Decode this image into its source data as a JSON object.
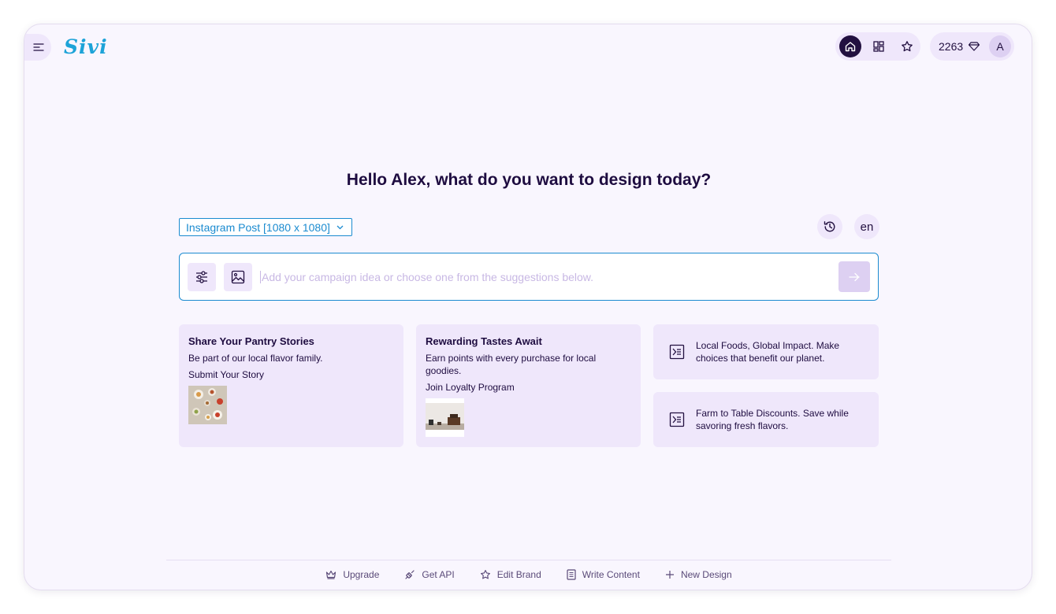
{
  "app": {
    "logo_text": "Sivi"
  },
  "header": {
    "nav": [
      {
        "icon": "home-icon",
        "active": true
      },
      {
        "icon": "grid-icon",
        "active": false
      },
      {
        "icon": "star-icon",
        "active": false
      }
    ],
    "credits": "2263",
    "avatar_initial": "A"
  },
  "main": {
    "heading": "Hello Alex, what do you want to design today?",
    "format_select": "Instagram Post [1080 x 1080]",
    "language": "en",
    "prompt_placeholder": "Add your campaign idea or choose one from the suggestions below."
  },
  "cards": [
    {
      "title": "Share Your Pantry Stories",
      "description": "Be part of our local flavor family.",
      "cta": "Submit Your Story",
      "image": "pantry-food-photo"
    },
    {
      "title": "Rewarding Tastes Await",
      "description": "Earn points with every purchase for local goodies.",
      "cta": "Join Loyalty Program",
      "image": "room-interior-photo"
    }
  ],
  "suggestions": [
    {
      "text": "Local Foods, Global Impact. Make choices that benefit our planet."
    },
    {
      "text": "Farm to Table Discounts. Save while savoring fresh flavors."
    }
  ],
  "footer": [
    {
      "label": "Upgrade",
      "icon": "crown-icon"
    },
    {
      "label": "Get API",
      "icon": "plug-icon"
    },
    {
      "label": "Edit Brand",
      "icon": "star-icon"
    },
    {
      "label": "Write Content",
      "icon": "document-icon"
    },
    {
      "label": "New Design",
      "icon": "plus-icon"
    }
  ],
  "colors": {
    "accent": "#1b8bd0",
    "dark": "#1e0c40",
    "surface": "#efe7fb",
    "background": "#f9f6fe"
  }
}
